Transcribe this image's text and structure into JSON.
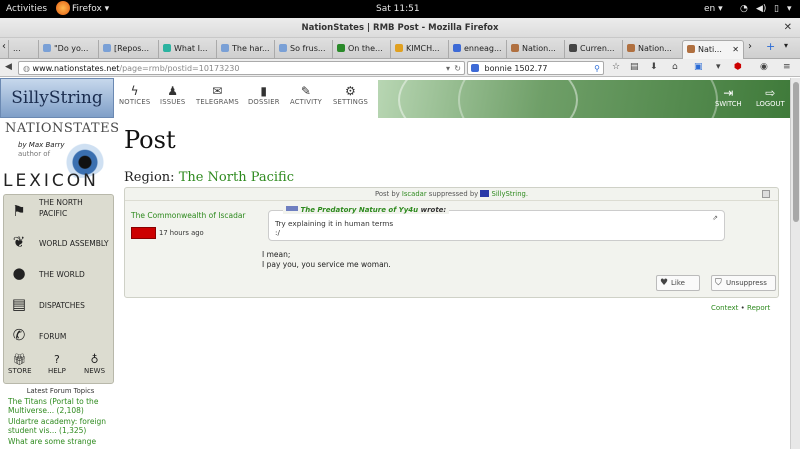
{
  "system": {
    "activities": "Activities",
    "app_menu": "Firefox ▾",
    "clock": "Sat 11:51",
    "locale": "en ▾"
  },
  "window": {
    "title": "NationStates | RMB Post - Mozilla Firefox"
  },
  "tabs": [
    {
      "label": "..."
    },
    {
      "label": "\"Do yo..."
    },
    {
      "label": "[Repos..."
    },
    {
      "label": "What I..."
    },
    {
      "label": "The har..."
    },
    {
      "label": "So frus..."
    },
    {
      "label": "On the..."
    },
    {
      "label": "KIMCH..."
    },
    {
      "label": "enneag..."
    },
    {
      "label": "Nation..."
    },
    {
      "label": "Curren..."
    },
    {
      "label": "Nation..."
    },
    {
      "label": "Nati..."
    }
  ],
  "nav": {
    "url_host": "www.nationstates.net",
    "url_path": "/page=rmb/postid=10173230",
    "search_value": "bonnie 1502.77"
  },
  "header": {
    "logo": "SillyString",
    "items": [
      "NOTICES",
      "ISSUES",
      "TELEGRAMS",
      "DOSSIER",
      "ACTIVITY",
      "SETTINGS"
    ],
    "switch": "SWITCH",
    "logout": "LOGOUT"
  },
  "sidebar": {
    "site_title": "NATIONSTATES",
    "byline": "by Max Barry",
    "author_of": "author of",
    "lexicon": "LEXICON",
    "nav_items": [
      "THE NORTH PACIFIC",
      "WORLD ASSEMBLY",
      "THE WORLD",
      "DISPATCHES",
      "FORUM"
    ],
    "small_items": [
      "STORE",
      "HELP",
      "NEWS"
    ],
    "forum_title": "Latest Forum Topics",
    "forum_topics": [
      "The Titans (Portal to the Multiverse... (2,108)",
      "Uldartre academy: foreign student vis... (1,325)",
      "What are some strange"
    ]
  },
  "main": {
    "page_title": "Post",
    "region_label": "Region:",
    "region_name": "The North Pacific",
    "post": {
      "head_prefix": "Post by",
      "head_author": "Iscadar",
      "head_middle": "suppressed by",
      "head_suppressor": "SillyString.",
      "author": "The Commonwealth of Iscadar",
      "time": "17 hours ago",
      "quote_author": "The Predatory Nature of Yy4u",
      "quote_wrote": "wrote:",
      "quote_line1": "Try explaining it in human terms",
      "quote_line2": ":/",
      "body_line1": "I mean;",
      "body_line2": "I pay you, you service me woman.",
      "like": "Like",
      "unsuppress": "Unsuppress"
    },
    "context": "Context",
    "report": "Report"
  },
  "colors": {
    "link_green": "#2e8a1e",
    "panel": "#f2f3ee",
    "sidebar_panel": "#dcdcd0"
  }
}
